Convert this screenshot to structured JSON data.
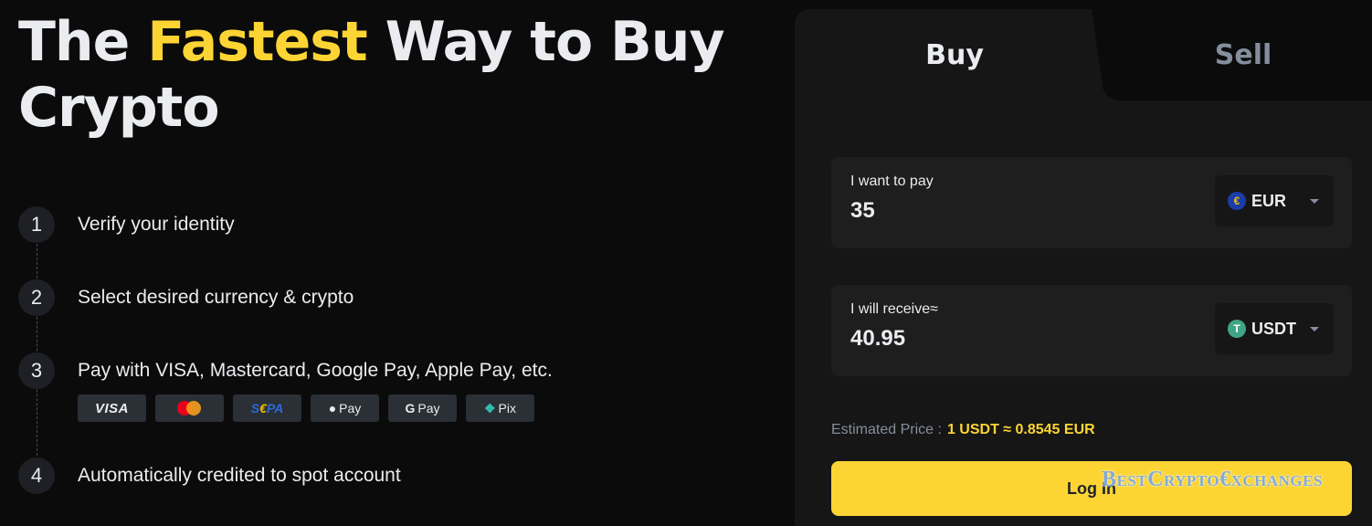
{
  "hero": {
    "title_before": "The ",
    "title_accent": "Fastest",
    "title_after": " Way to Buy Crypto"
  },
  "steps": [
    {
      "number": "1",
      "text": "Verify your identity"
    },
    {
      "number": "2",
      "text": "Select desired currency & crypto"
    },
    {
      "number": "3",
      "text": "Pay with VISA, Mastercard, Google Pay, Apple Pay, etc."
    },
    {
      "number": "4",
      "text": "Automatically credited to spot account"
    }
  ],
  "payment_methods": {
    "visa": "VISA",
    "mastercard_icon": "mastercard-logo",
    "sepa_prefix": "S",
    "sepa_euro": "€",
    "sepa_suffix": "PA",
    "apple_glyph": "",
    "apple_pay": "Pay",
    "google_glyph": "G",
    "google_pay": "Pay",
    "pix_glyph": "❖",
    "pix": "Pix"
  },
  "tabs": {
    "buy": "Buy",
    "sell": "Sell",
    "active": "Buy"
  },
  "pay": {
    "label": "I want to pay",
    "value": "35",
    "currency": "EUR",
    "currency_icon": "€"
  },
  "receive": {
    "label": "I will receive≈",
    "value": "40.95",
    "currency": "USDT",
    "currency_icon": "T"
  },
  "estimate": {
    "label": "Estimated Price :",
    "value": "1 USDT ≈ 0.8545 EUR"
  },
  "login_button": "Log In",
  "watermark": "BestCrypto€xchanges",
  "colors": {
    "accent": "#fcd535",
    "background": "#0b0b0b",
    "panel": "#161616",
    "muted": "#848e9c"
  }
}
